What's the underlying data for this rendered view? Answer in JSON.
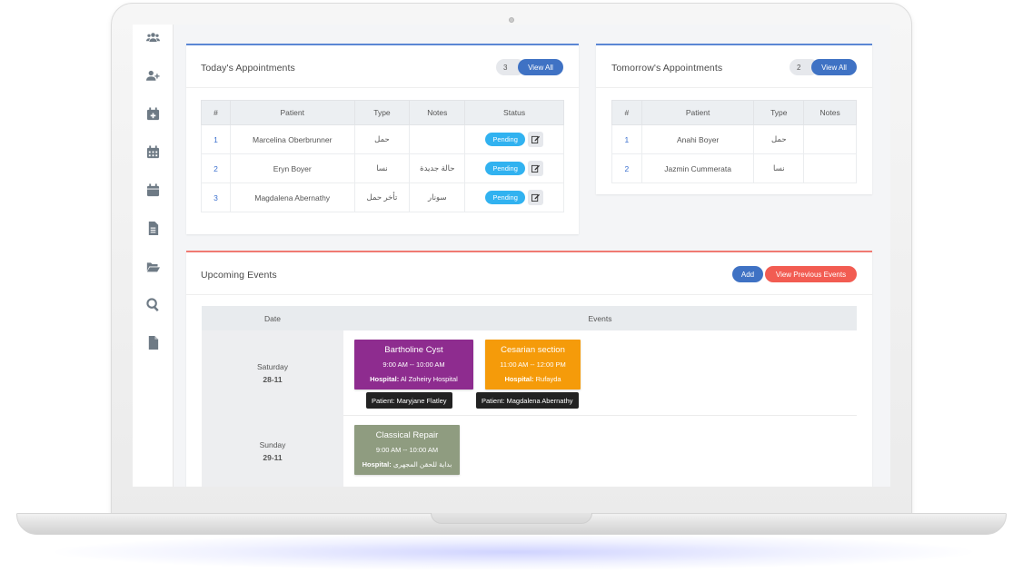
{
  "today": {
    "title": "Today's Appointments",
    "count": "3",
    "view_all": "View All",
    "columns": [
      "#",
      "Patient",
      "Type",
      "Notes",
      "Status"
    ],
    "rows": [
      {
        "num": "1",
        "patient": "Marcelina Oberbrunner",
        "type": "حمل",
        "notes": "",
        "status": "Pending"
      },
      {
        "num": "2",
        "patient": "Eryn Boyer",
        "type": "نسا",
        "notes": "حالة جديدة",
        "status": "Pending"
      },
      {
        "num": "3",
        "patient": "Magdalena Abernathy",
        "type": "تأخر حمل",
        "notes": "سونار",
        "status": "Pending"
      }
    ]
  },
  "tomorrow": {
    "title": "Tomorrow's Appointments",
    "count": "2",
    "view_all": "View All",
    "columns": [
      "#",
      "Patient",
      "Type",
      "Notes"
    ],
    "rows": [
      {
        "num": "1",
        "patient": "Anahi Boyer",
        "type": "حمل",
        "notes": ""
      },
      {
        "num": "2",
        "patient": "Jazmin Cummerata",
        "type": "نسا",
        "notes": ""
      }
    ]
  },
  "events": {
    "title": "Upcoming Events",
    "add_label": "Add",
    "previous_label": "View Previous Events",
    "col_date": "Date",
    "col_events": "Events",
    "days": [
      {
        "day": "Saturday",
        "date": "28-11",
        "items": [
          {
            "title": "Bartholine Cyst",
            "time": "9:00 AM -- 10:00 AM",
            "hospital_label": "Hospital:",
            "hospital": "Al Zoheiry Hospital",
            "patient": "Patient: Maryjane Flatley",
            "color": "#8e2c8f"
          },
          {
            "title": "Cesarian section",
            "time": "11:00 AM -- 12:00 PM",
            "hospital_label": "Hospital:",
            "hospital": "Rufayda",
            "patient": "Patient: Magdalena Abernathy",
            "color": "#f59b0a"
          }
        ]
      },
      {
        "day": "Sunday",
        "date": "29-11",
        "items": [
          {
            "title": "Classical Repair",
            "time": "9:00 AM -- 10:00 AM",
            "hospital_label": "Hospital:",
            "hospital": "بداية للحقن المجهرى",
            "color": "#8f9c80"
          }
        ]
      }
    ]
  },
  "colors": {
    "primary": "#3f72c4",
    "danger": "#f25c52",
    "info": "#31b2f0"
  },
  "sidebar": {
    "icons": [
      "users-icon",
      "add-user-icon",
      "calendar-plus-icon",
      "calendar-icon",
      "calendar-day-icon",
      "file-icon",
      "folder-open-icon",
      "search-icon",
      "document-icon"
    ]
  }
}
